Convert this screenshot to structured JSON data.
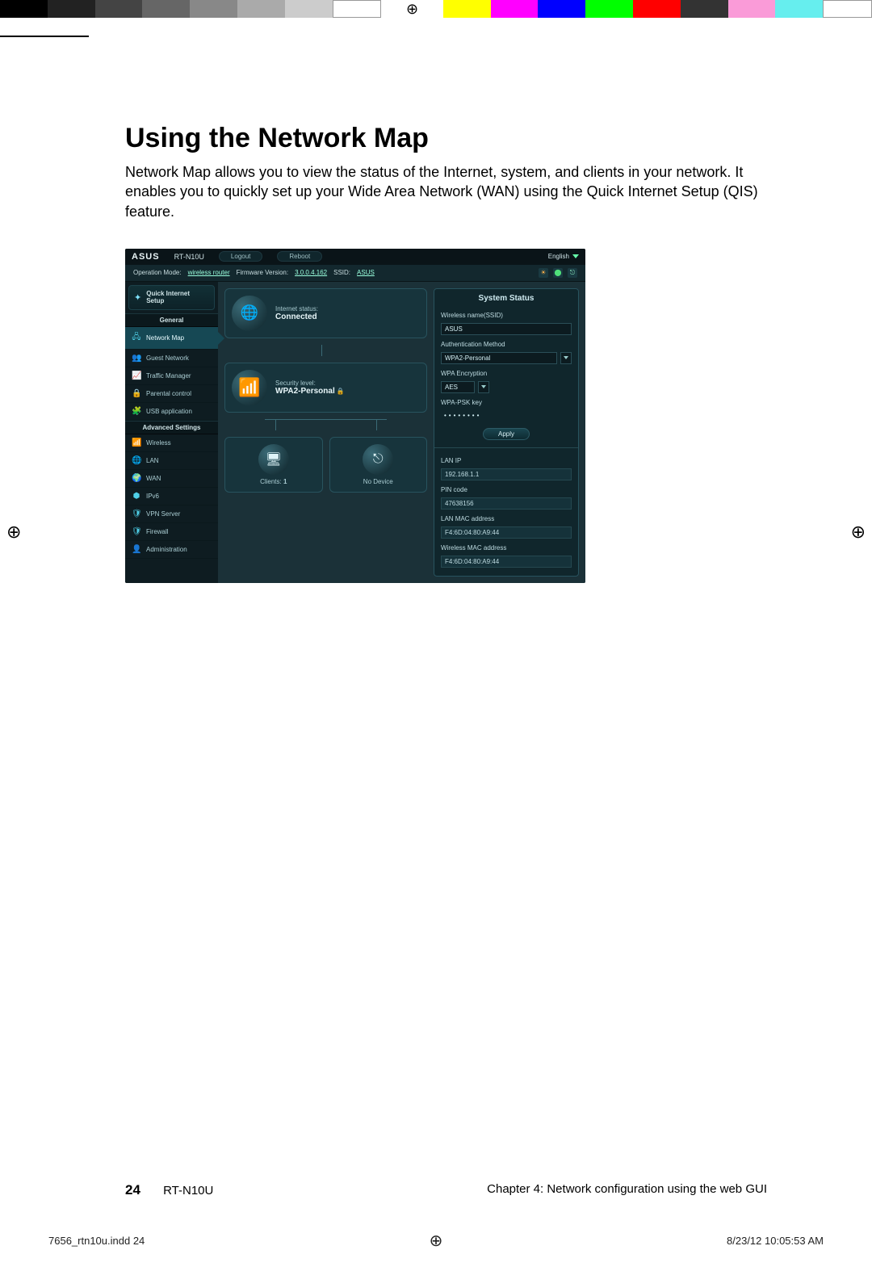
{
  "document": {
    "heading": "Using the Network Map",
    "paragraph": "Network Map allows you to view the status of the Internet, system, and clients in your network. It enables you to quickly set up your Wide Area Network (WAN) using the Quick Internet Setup (QIS) feature.",
    "page_number": "24",
    "model": "RT-N10U",
    "chapter": "Chapter 4: Network configuration using the web GUI",
    "indd": "7656_rtn10u.indd   24",
    "timestamp": "8/23/12   10:05:53 AM"
  },
  "router": {
    "brand": "ASUS",
    "model": "RT-N10U",
    "logout": "Logout",
    "reboot": "Reboot",
    "language": "English",
    "infobar": {
      "op_mode_label": "Operation Mode:",
      "op_mode_value": "wireless router",
      "fw_label": "Firmware Version:",
      "fw_value": "3.0.0.4.162",
      "ssid_label": "SSID:",
      "ssid_value": "ASUS"
    },
    "sidebar": {
      "qis": "Quick Internet Setup",
      "general_heading": "General",
      "general": [
        "Network Map",
        "Guest Network",
        "Traffic Manager",
        "Parental control",
        "USB application"
      ],
      "adv_heading": "Advanced Settings",
      "advanced": [
        "Wireless",
        "LAN",
        "WAN",
        "IPv6",
        "VPN Server",
        "Firewall",
        "Administration"
      ]
    },
    "cards": {
      "internet_label": "Internet status:",
      "internet_value": "Connected",
      "security_label": "Security level:",
      "security_value": "WPA2-Personal",
      "clients_label": "Clients:",
      "clients_count": "1",
      "usb_label": "No Device"
    },
    "status_panel": {
      "title": "System Status",
      "ssid_label": "Wireless name(SSID)",
      "ssid_value": "ASUS",
      "auth_label": "Authentication Method",
      "auth_value": "WPA2-Personal",
      "enc_label": "WPA Encryption",
      "enc_value": "AES",
      "psk_label": "WPA-PSK key",
      "psk_value": "••••••••",
      "apply": "Apply",
      "lanip_label": "LAN IP",
      "lanip_value": "192.168.1.1",
      "pin_label": "PIN code",
      "pin_value": "47638156",
      "lanmac_label": "LAN MAC address",
      "lanmac_value": "F4:6D:04:80:A9:44",
      "wmac_label": "Wireless MAC address",
      "wmac_value": "F4:6D:04:80:A9:44"
    }
  }
}
